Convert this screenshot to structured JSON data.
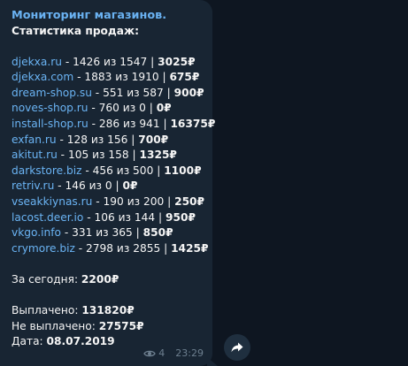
{
  "post": {
    "title": "Мониторинг магазинов.",
    "subtitle": "Статистика продаж:",
    "stats": [
      {
        "site": "djekxa.ru",
        "text": " - 1426 из 1547 | ",
        "amount": "3025₽"
      },
      {
        "site": "djekxa.com",
        "text": " - 1883 из 1910 | ",
        "amount": "675₽"
      },
      {
        "site": "dream-shop.su",
        "text": " - 551 из 587 | ",
        "amount": "900₽"
      },
      {
        "site": "noves-shop.ru",
        "text": " - 760 из 0 | ",
        "amount": "0₽"
      },
      {
        "site": "install-shop.ru",
        "text": " - 286 из 941 | ",
        "amount": "16375₽"
      },
      {
        "site": "exfan.ru",
        "text": " - 128 из 156 | ",
        "amount": "700₽"
      },
      {
        "site": "akitut.ru",
        "text": " - 105 из 158 | ",
        "amount": "1325₽"
      },
      {
        "site": "darkstore.biz",
        "text": " - 456 из 500 | ",
        "amount": "1100₽"
      },
      {
        "site": "retriv.ru",
        "text": " - 146 из 0 | ",
        "amount": "0₽"
      },
      {
        "site": "vseakkiynas.ru",
        "text": " - 190 из 200 | ",
        "amount": "250₽"
      },
      {
        "site": "lacost.deer.io",
        "text": " - 106 из 144 | ",
        "amount": "950₽"
      },
      {
        "site": "vkgo.info",
        "text": " - 331 из 365 | ",
        "amount": "850₽"
      },
      {
        "site": "crymore.biz",
        "text": " - 2798 из 2855 | ",
        "amount": "1425₽"
      }
    ],
    "today_label": "За сегодня: ",
    "today_value": "2200₽",
    "paid_label": "Выплачено: ",
    "paid_value": "131820₽",
    "unpaid_label": "Не выплачено: ",
    "unpaid_value": "27575₽",
    "date_label": "Дата: ",
    "date_value": "08.07.2019",
    "views": "4",
    "time": "23:29"
  },
  "icons": {
    "views": "eye-icon",
    "share": "share-arrow-icon"
  },
  "colors": {
    "background": "#0e1621",
    "bubble": "#182533",
    "link": "#6ab3f3",
    "meta": "#6d7f8f"
  }
}
